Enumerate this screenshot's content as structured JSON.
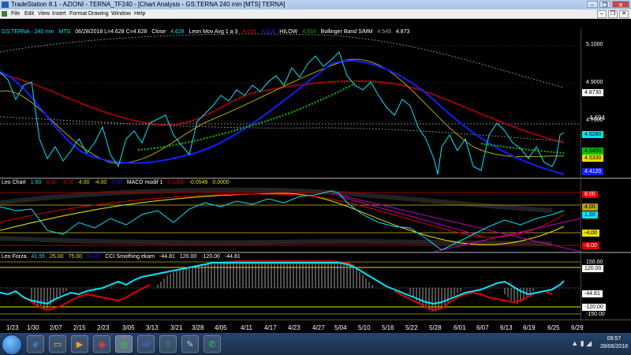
{
  "app": {
    "title": "TradeStation 8.1 - AZIONI - TERNA_TF240 - [Chart Analysis - GS:TERNA  240 min  [MTS] TERNA]",
    "window_buttons": [
      "–",
      "❐",
      "✕"
    ]
  },
  "menu": {
    "items": [
      "File",
      "Edit",
      "View",
      "Insert",
      "Format",
      "Drawing",
      "Window",
      "Help"
    ]
  },
  "price_pane": {
    "symbol": "GS:TERNA - 240 min",
    "exchange": "MTS",
    "ohlc": "06/28/2018  L=4.628  C=4.628",
    "close_label": "Close",
    "close_value": "4.628",
    "indicator1_name": "Leon Mov Avg 1 a 3",
    "indicator1_values": [
      "4.516",
      "4.516",
      "4.533"
    ],
    "indicator2_name": "HILOW",
    "indicator2_value": "4.533",
    "indicator3_name": "Bollinger Band S/MM",
    "indicator3_values": [
      "4.549",
      "4.873"
    ],
    "scale_ticks": [
      "5.1000",
      "4.9000",
      "4.7000"
    ],
    "labels": {
      "upper_band": "4.8730",
      "hline": "4.694",
      "close": "4.6280",
      "mid1": "4.5490",
      "mid2": "4.5330",
      "mid3": "4.5160",
      "lower": "4.4120"
    },
    "colors": {
      "close": "#00e5ff",
      "ma_red": "#e00000",
      "ma_blue": "#1020ff",
      "ma_olive": "#b8a400",
      "hilow": "#00c000",
      "bollinger": "#a0a0a0"
    }
  },
  "leon_chart_pane": {
    "title": "Leo Chart",
    "values": [
      "1.60",
      "8.00",
      "-8.00",
      "4.00",
      "-4.00",
      "0.00"
    ],
    "indicator_name": "MACD modif 1",
    "indicator_values": [
      "0.1000",
      "-0.0548",
      "0.0000"
    ],
    "labels": [
      "8.00",
      "4.00",
      "1.60",
      "-4.00",
      "-8.00"
    ]
  },
  "forza_pane": {
    "title": "Leo Forza",
    "values": [
      "41.55",
      "25.00",
      "75.00",
      "50.00"
    ],
    "indicator_name": "CCI Smothing ekam",
    "indicator_values": [
      "-44.81",
      "120.00",
      "-120.00",
      "-44.81"
    ],
    "labels": [
      "150.00",
      "120.00",
      "-44.81",
      "-120.00",
      "-150.00"
    ]
  },
  "x_axis": {
    "dates": [
      "1/23",
      "1/30",
      "2/07",
      "2/15",
      "2/23",
      "3/05",
      "3/13",
      "3/21",
      "3/28",
      "4/05",
      "4/11",
      "4/17",
      "4/23",
      "4/27",
      "5/04",
      "5/10",
      "5/16",
      "5/22",
      "5/28",
      "6/01",
      "6/07",
      "6/13",
      "6/19",
      "6/25",
      "6/29"
    ]
  },
  "taskbar": {
    "icons": [
      "ie-icon",
      "folder-icon",
      "media-player-icon",
      "chrome-icon",
      "tradestation-icon",
      "word-icon",
      "excel-icon",
      "paint-icon",
      "whatsapp-icon"
    ],
    "time": "09:57",
    "date": "28/06/2018"
  }
}
